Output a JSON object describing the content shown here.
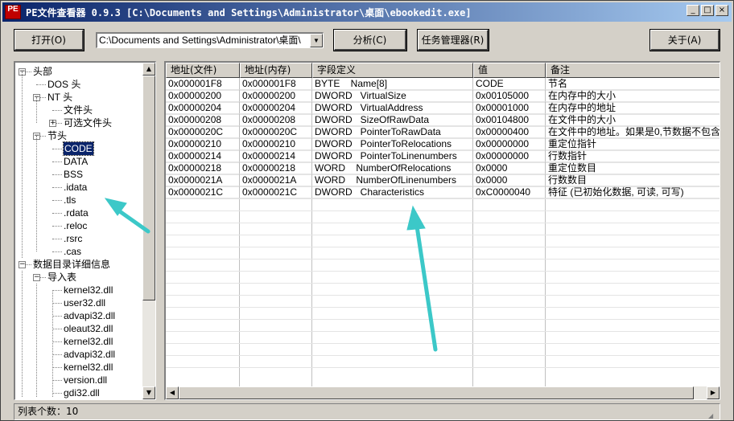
{
  "window": {
    "icon_text": "PE",
    "title": "PE文件查看器 0.9.3 [C:\\Documents and Settings\\Administrator\\桌面\\ebookedit.exe]",
    "caption": {
      "minimize": "_",
      "maximize": "□",
      "close": "×"
    }
  },
  "toolbar": {
    "open_label": "打开(O)",
    "path_value": "C:\\Documents and Settings\\Administrator\\桌面\\",
    "analyze_label": "分析(C)",
    "taskmgr_label": "任务管理器(R)",
    "about_label": "关于(A)"
  },
  "tree": {
    "items": [
      {
        "label": "头部",
        "expander": "−"
      },
      {
        "label": "DOS 头"
      },
      {
        "label": "NT 头",
        "expander": "−"
      },
      {
        "label": "文件头"
      },
      {
        "label": "可选文件头",
        "expander": "+"
      },
      {
        "label": "节头",
        "expander": "−"
      },
      {
        "label": "CODE",
        "selected": true
      },
      {
        "label": "DATA"
      },
      {
        "label": "BSS"
      },
      {
        "label": ".idata"
      },
      {
        "label": ".tls"
      },
      {
        "label": ".rdata"
      },
      {
        "label": ".reloc"
      },
      {
        "label": ".rsrc"
      },
      {
        "label": ".cas"
      },
      {
        "label": "数据目录详细信息",
        "expander": "−"
      },
      {
        "label": "导入表",
        "expander": "−"
      },
      {
        "label": "kernel32.dll"
      },
      {
        "label": "user32.dll"
      },
      {
        "label": "advapi32.dll"
      },
      {
        "label": "oleaut32.dll"
      },
      {
        "label": "kernel32.dll"
      },
      {
        "label": "advapi32.dll"
      },
      {
        "label": "kernel32.dll"
      },
      {
        "label": "version.dll"
      },
      {
        "label": "gdi32.dll"
      }
    ]
  },
  "table": {
    "columns": [
      "地址(文件)",
      "地址(内存)",
      "字段定义",
      "值",
      "备注"
    ],
    "rows": [
      [
        "0x000001F8",
        "0x000001F8",
        "BYTE    Name[8]",
        "CODE",
        "节名"
      ],
      [
        "0x00000200",
        "0x00000200",
        "DWORD   VirtualSize",
        "0x00105000",
        "在内存中的大小"
      ],
      [
        "0x00000204",
        "0x00000204",
        "DWORD   VirtualAddress",
        "0x00001000",
        "在内存中的地址"
      ],
      [
        "0x00000208",
        "0x00000208",
        "DWORD   SizeOfRawData",
        "0x00104800",
        "在文件中的大小"
      ],
      [
        "0x0000020C",
        "0x0000020C",
        "DWORD   PointerToRawData",
        "0x00000400",
        "在文件中的地址。如果是0,节数据不包含"
      ],
      [
        "0x00000210",
        "0x00000210",
        "DWORD   PointerToRelocations",
        "0x00000000",
        "重定位指针"
      ],
      [
        "0x00000214",
        "0x00000214",
        "DWORD   PointerToLinenumbers",
        "0x00000000",
        "行数指针"
      ],
      [
        "0x00000218",
        "0x00000218",
        "WORD    NumberOfRelocations",
        "0x0000",
        "重定位数目"
      ],
      [
        "0x0000021A",
        "0x0000021A",
        "WORD    NumberOfLinenumbers",
        "0x0000",
        "行数数目"
      ],
      [
        "0x0000021C",
        "0x0000021C",
        "DWORD   Characteristics",
        "0xC0000040",
        "特征 (已初始化数据, 可读, 可写)"
      ]
    ]
  },
  "status": {
    "text": "列表个数：10"
  },
  "colors": {
    "titlebar_start": "#0a246a",
    "titlebar_end": "#a6caf0",
    "selection": "#0a246a",
    "annotation_arrow": "#3cc8c8",
    "face": "#d4d0c8"
  },
  "icons": [
    "minimize-icon",
    "maximize-icon",
    "close-icon",
    "dropdown-arrow-icon",
    "scroll-up-icon",
    "scroll-down-icon",
    "scroll-left-icon",
    "scroll-right-icon"
  ]
}
